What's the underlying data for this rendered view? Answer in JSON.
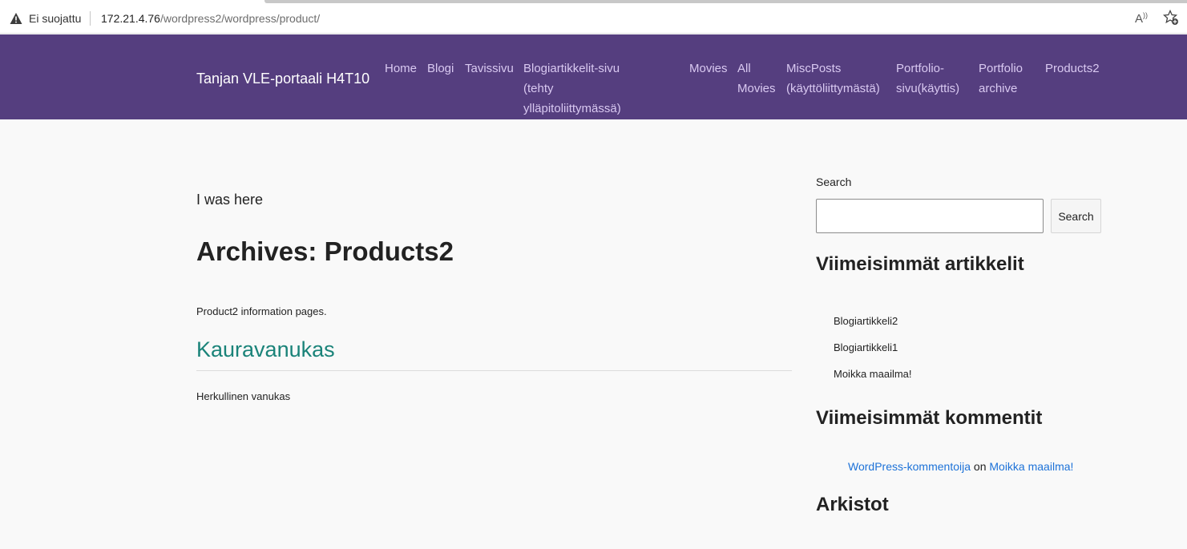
{
  "browser": {
    "security_label": "Ei suojattu",
    "url_host": "172.21.4.76",
    "url_path": "/wordpress2/wordpress/product/",
    "icons": [
      "warning-icon",
      "read-aloud-icon",
      "add-favorite-icon"
    ]
  },
  "header": {
    "site_title": "Tanjan VLE-portaali H4T10",
    "nav": [
      {
        "label": "Home"
      },
      {
        "label": "Blogi"
      },
      {
        "label": "Tavissivu"
      },
      {
        "label_line1": "Blogiartikkelit-sivu (tehty",
        "label_line2": "ylläpitoliittymässä)"
      },
      {
        "label": "Movies"
      },
      {
        "label_line1": "All",
        "label_line2": "Movies"
      },
      {
        "label_line1": "MiscPosts",
        "label_line2": "(käyttöliittymästä)"
      },
      {
        "label_line1": "Portfolio-",
        "label_line2": "sivu(käyttis)"
      },
      {
        "label_line1": "Portfolio",
        "label_line2": "archive"
      },
      {
        "label": "Products2"
      }
    ]
  },
  "main": {
    "intro": "I was here",
    "archive_title": "Archives: Products2",
    "archive_description": "Product2 information pages.",
    "posts": [
      {
        "title": "Kauravanukas",
        "excerpt": "Herkullinen vanukas"
      }
    ]
  },
  "sidebar": {
    "search": {
      "label": "Search",
      "input_value": "",
      "button_label": "Search"
    },
    "recent_posts_title": "Viimeisimmät artikkelit",
    "recent_posts": [
      "Blogiartikkeli2",
      "Blogiartikkeli1",
      "Moikka maailma!"
    ],
    "recent_comments_title": "Viimeisimmät kommentit",
    "recent_comment": {
      "author": "WordPress-kommentoija",
      "connector": "on",
      "post": "Moikka maailma!"
    },
    "archives_title": "Arkistot"
  },
  "colors": {
    "header_bg": "#553e7f",
    "nav_link": "#d9c9f1",
    "post_title": "#1a8379",
    "comment_link": "#1d72d8"
  }
}
